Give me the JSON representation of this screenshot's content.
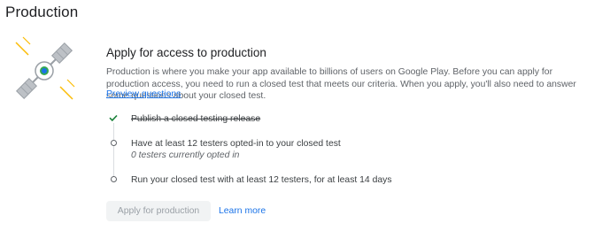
{
  "page": {
    "title": "Production"
  },
  "card": {
    "title": "Apply for access to production",
    "description": "Production is where you make your app available to billions of users on Google Play. Before you can apply for production access, you need to run a closed test that meets our criteria. When you apply, you'll also need to answer some questions about your closed test.",
    "preview_link": "Preview questions"
  },
  "steps": [
    {
      "label": "Publish a closed testing release",
      "status": "completed"
    },
    {
      "label": "Have at least 12 testers opted-in to your closed test",
      "detail": "0 testers currently opted in",
      "status": "pending"
    },
    {
      "label": "Run your closed test with at least 12 testers, for at least 14 days",
      "status": "pending"
    }
  ],
  "actions": {
    "apply_label": "Apply for production",
    "learn_more_label": "Learn more"
  },
  "colors": {
    "accent": "#1a73e8",
    "completed": "#188038",
    "satellite_panel": "#bdc1c6",
    "satellite_core": "#1a73e8",
    "rays": "#fbbc04",
    "disabled_button_bg": "#f1f3f4",
    "disabled_button_text": "#9aa0a6"
  },
  "icons": {
    "illustration": "satellite-illustration",
    "completed": "check-icon",
    "pending": "circle-outline-icon"
  }
}
